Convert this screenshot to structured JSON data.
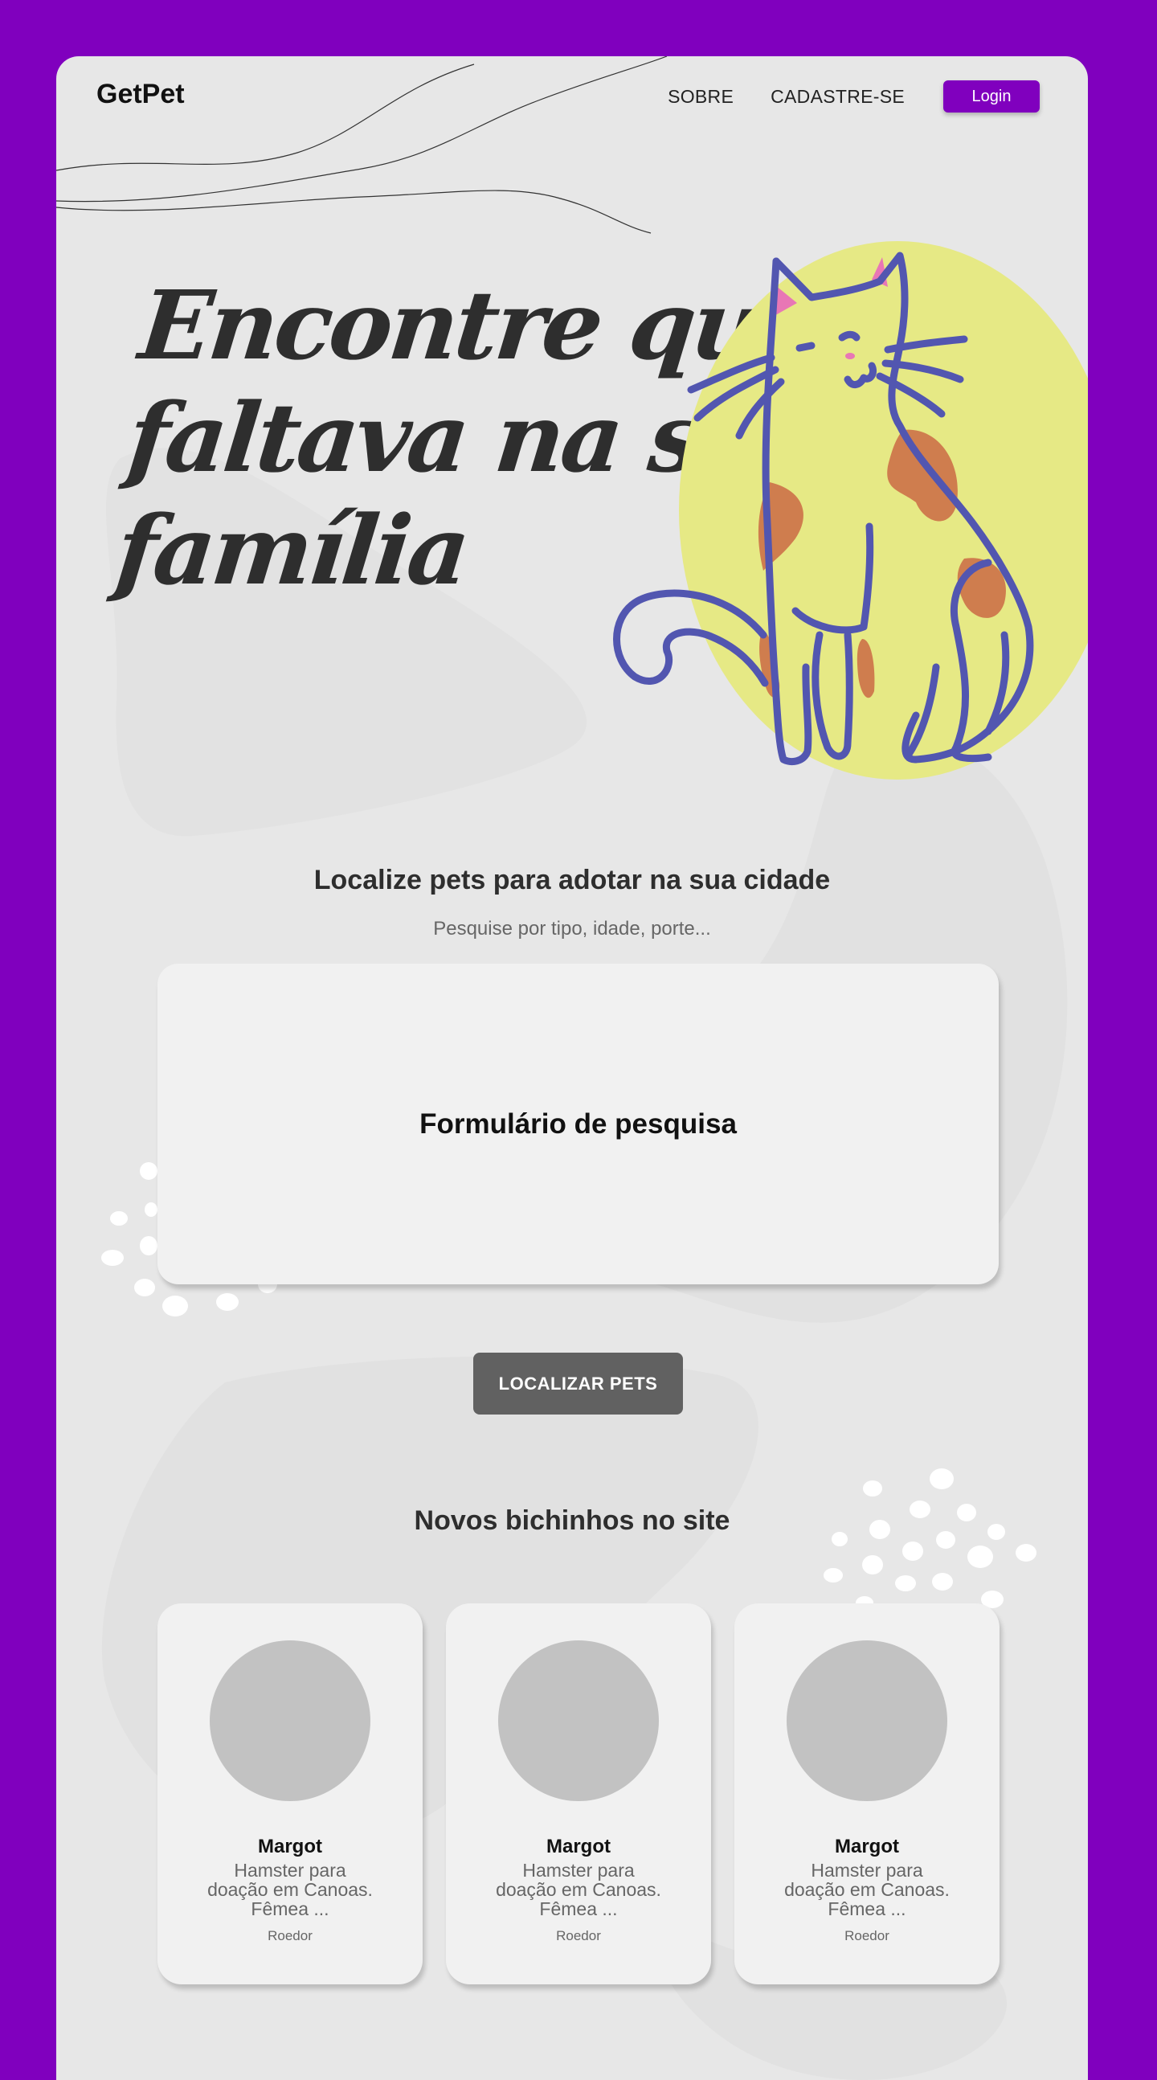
{
  "brand": {
    "logo": "GetPet",
    "accent_color": "#8000be"
  },
  "nav": {
    "links": [
      "SOBRE",
      "CADASTRE-SE"
    ],
    "login_label": "Login"
  },
  "hero": {
    "title_lines": [
      "Encontre quem",
      "faltava na sua",
      "família"
    ],
    "illustration": "cat-illustration"
  },
  "search": {
    "title": "Localize pets para adotar na sua cidade",
    "subtitle": "Pesquise por tipo, idade, porte...",
    "form_title": "Formulário de pesquisa",
    "button_label": "LOCALIZAR PETS"
  },
  "new_pets": {
    "title": "Novos bichinhos no site",
    "cards": [
      {
        "name": "Margot",
        "description": "Hamster para doação em Canoas. Fêmea ...",
        "type": "Roedor"
      },
      {
        "name": "Margot",
        "description": "Hamster para doação em Canoas. Fêmea ...",
        "type": "Roedor"
      },
      {
        "name": "Margot",
        "description": "Hamster para doação em Canoas. Fêmea ...",
        "type": "Roedor"
      }
    ]
  }
}
